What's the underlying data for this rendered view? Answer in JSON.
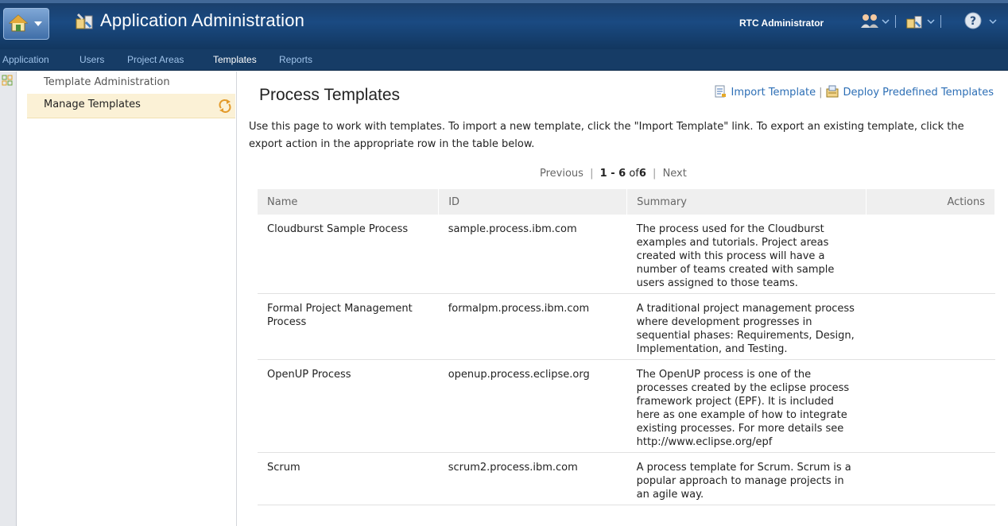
{
  "header": {
    "title": "Application Administration",
    "user": "RTC Administrator"
  },
  "nav": {
    "items": [
      {
        "label": "Application"
      },
      {
        "label": "Users"
      },
      {
        "label": "Project Areas"
      },
      {
        "label": "Templates",
        "active": true
      },
      {
        "label": "Reports"
      }
    ]
  },
  "sidebar": {
    "header": "Template Administration",
    "items": [
      {
        "label": "Manage Templates",
        "selected": true
      }
    ]
  },
  "main": {
    "title": "Process Templates",
    "import_link": "Import Template",
    "deploy_link": "Deploy Predefined Templates",
    "separator": "|",
    "description": "Use this page to work with templates. To import a new template, click the \"Import Template\" link. To export an existing template, click the export action in the appropriate row in the table below.",
    "pager": {
      "previous": "Previous",
      "range": "1 - 6",
      "of": "of",
      "total": "6",
      "next": "Next"
    }
  },
  "table": {
    "columns": [
      "Name",
      "ID",
      "Summary",
      "Actions"
    ],
    "rows": [
      {
        "name": "Cloudburst Sample Process",
        "id": "sample.process.ibm.com",
        "summary": "The process used for the Cloudburst examples and tutorials. Project areas created with this process will have a number of teams created with sample users assigned to those teams."
      },
      {
        "name": "Formal Project Management Process",
        "id": "formalpm.process.ibm.com",
        "summary": "A traditional project management process where development progresses in sequential phases: Requirements, Design, Implementation, and Testing."
      },
      {
        "name": "OpenUP Process",
        "id": "openup.process.eclipse.org",
        "summary": "The OpenUP process is one of the processes created by the eclipse process framework project (EPF). It is included here as one example of how to integrate existing processes. For more details see http://www.eclipse.org/epf"
      },
      {
        "name": "Scrum",
        "id": "scrum2.process.ibm.com",
        "summary": "A process template for Scrum. Scrum is a popular approach to manage projects in an agile way."
      }
    ]
  },
  "colors": {
    "banner": "#1a4a82",
    "nav": "#163c66",
    "link": "#2c6eb5",
    "selected_item": "#fbf1d6"
  }
}
